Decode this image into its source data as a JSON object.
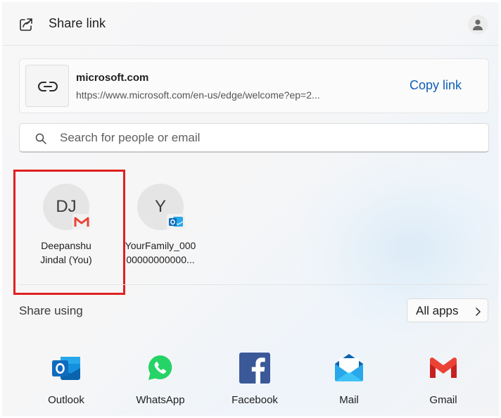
{
  "header": {
    "title": "Share link",
    "share_icon": "share-icon",
    "profile_icon": "profile-icon"
  },
  "link": {
    "domain": "microsoft.com",
    "url": "https://www.microsoft.com/en-us/edge/welcome?ep=2...",
    "copy_label": "Copy link",
    "icon": "link-icon"
  },
  "search": {
    "placeholder": "Search for people or email",
    "value": "",
    "icon": "search-icon"
  },
  "contacts": [
    {
      "initials": "DJ",
      "name_line1": "Deepanshu",
      "name_line2": "Jindal (You)",
      "badge": "gmail-icon"
    },
    {
      "initials": "Y",
      "name_line1": "YourFamily_000",
      "name_line2": "00000000000...",
      "badge": "outlook-icon"
    }
  ],
  "share_using": {
    "label": "Share using",
    "all_apps_label": "All apps",
    "apps": [
      {
        "label": "Outlook",
        "icon": "outlook-icon"
      },
      {
        "label": "WhatsApp",
        "icon": "whatsapp-icon"
      },
      {
        "label": "Facebook",
        "icon": "facebook-icon"
      },
      {
        "label": "Mail",
        "icon": "mail-icon"
      },
      {
        "label": "Gmail",
        "icon": "gmail-icon"
      }
    ]
  },
  "colors": {
    "accent": "#0f5fb6",
    "highlight": "#e02020",
    "outlook": "#0f6cbd",
    "whatsapp": "#25d366",
    "facebook": "#1877f2",
    "gmail_red": "#ea4335"
  }
}
